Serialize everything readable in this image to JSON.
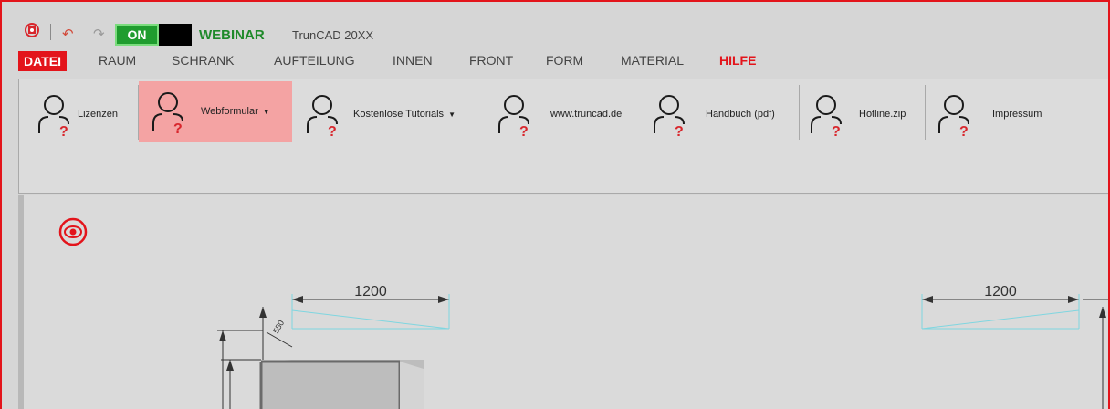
{
  "titlebar": {
    "toggle_on": "ON",
    "webinar": "WEBINAR",
    "app_title": "TrunCAD 20XX"
  },
  "menu": {
    "items": [
      "DATEI",
      "RAUM",
      "SCHRANK",
      "AUFTEILUNG",
      "INNEN",
      "FRONT",
      "FORM",
      "MATERIAL",
      "HILFE"
    ]
  },
  "ribbon": {
    "buttons": [
      {
        "label": "Lizenzen"
      },
      {
        "label": "Webformular"
      },
      {
        "label": "Kostenlose Tutorials"
      },
      {
        "label": "www.truncad.de"
      },
      {
        "label": "Handbuch (pdf)"
      },
      {
        "label": "Hotline.zip"
      },
      {
        "label": "Impressum"
      }
    ]
  },
  "drawing": {
    "dim_top_left": "1200",
    "dim_depth": "550",
    "dim_top_right": "1200"
  },
  "colors": {
    "accent": "#e3141b",
    "green": "#1f9c2e",
    "highlight": "#f4a3a3"
  }
}
